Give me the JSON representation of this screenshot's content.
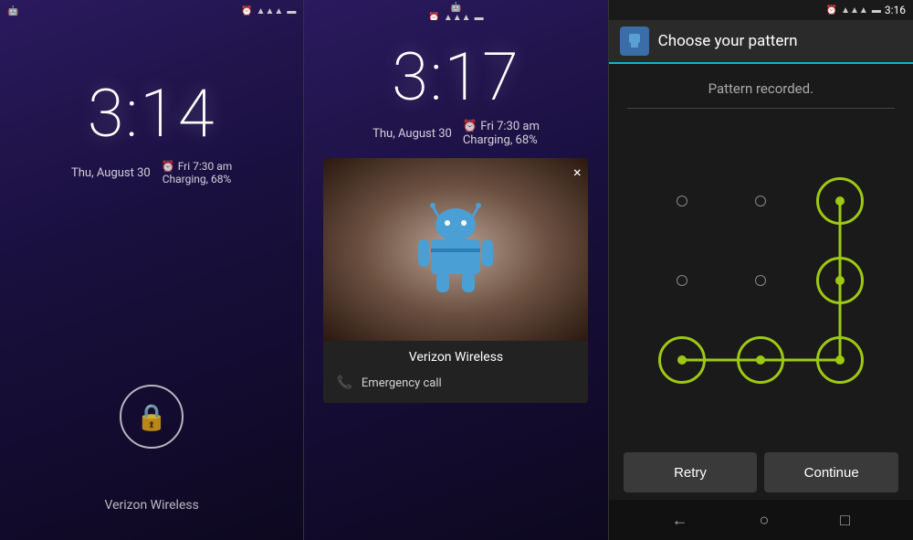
{
  "panel1": {
    "status_left_icon": "📱",
    "status_alarm": "⏰",
    "status_wifi": "📶",
    "status_battery": "🔋",
    "time": "3:14",
    "date": "Thu, August 30",
    "alarm_time": "Fri 7:30 am",
    "alarm_label": "Charging, 68%",
    "carrier": "Verizon Wireless"
  },
  "panel2": {
    "time": "3:17",
    "date": "Thu, August 30",
    "alarm_time": "Fri 7:30 am",
    "alarm_label": "Charging, 68%",
    "close_label": "×",
    "app_title": "Verizon Wireless",
    "emergency_label": "Emergency call"
  },
  "panel3": {
    "header_title": "Choose your pattern",
    "status_time": "3:16",
    "pattern_message": "Pattern recorded.",
    "retry_label": "Retry",
    "continue_label": "Continue",
    "nav_back": "←",
    "nav_home": "○",
    "nav_recents": "□"
  }
}
